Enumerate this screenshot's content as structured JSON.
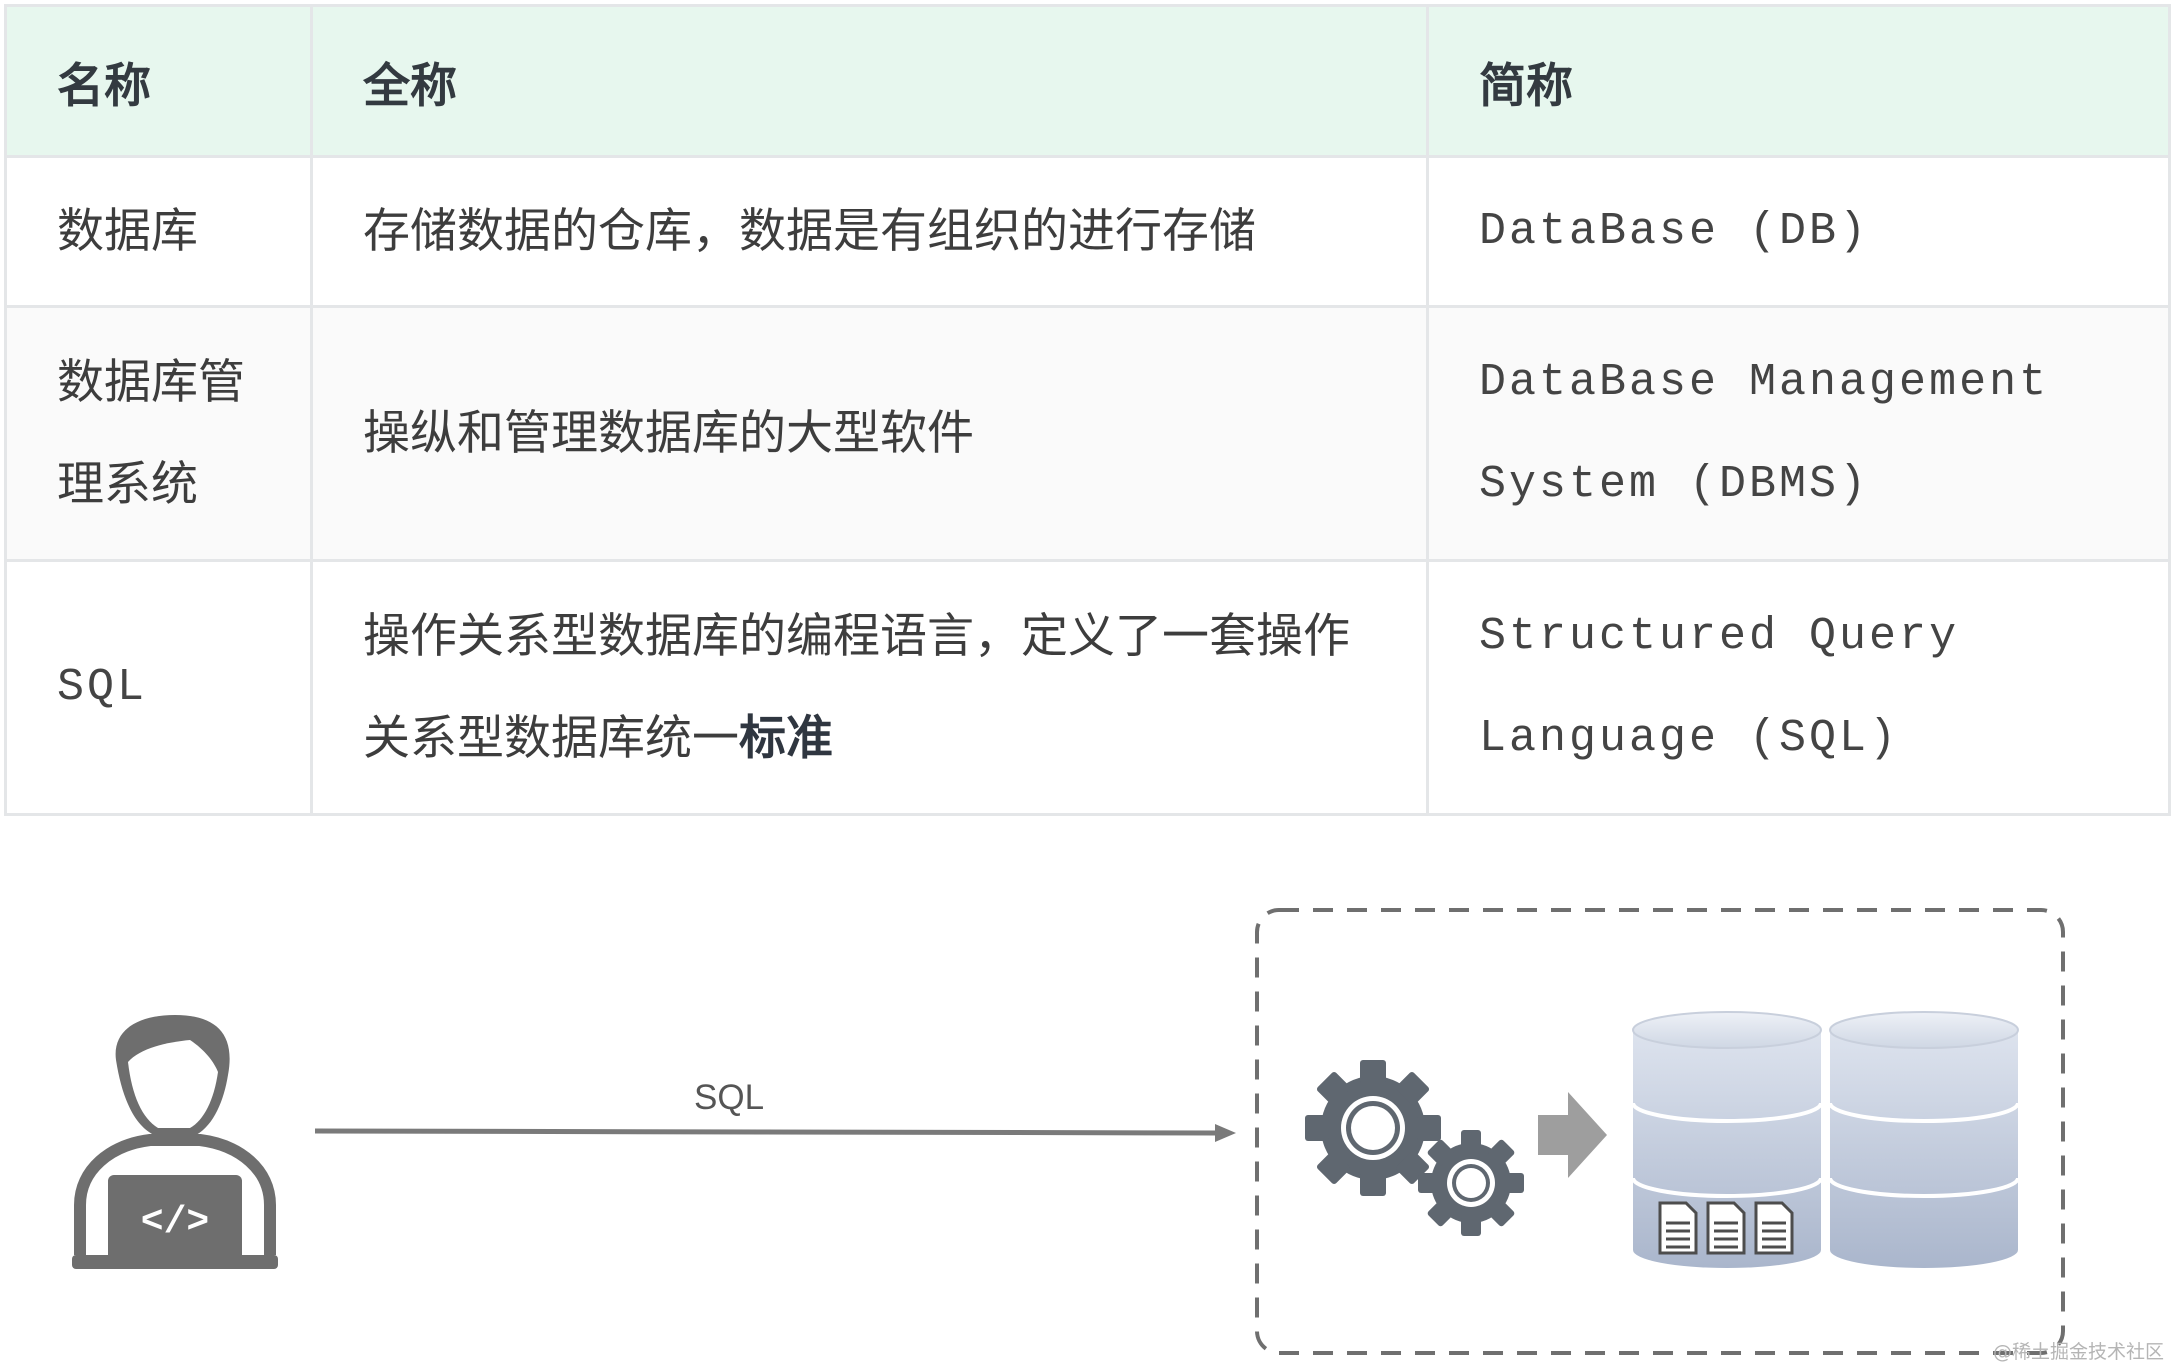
{
  "table": {
    "headers": [
      "名称",
      "全称",
      "简称"
    ],
    "rows": [
      {
        "name_lines": [
          "数据库"
        ],
        "full_lines": [
          "存储数据的仓库，数据是有组织的进行存储"
        ],
        "abbr_lines": [
          "DataBase (DB)"
        ]
      },
      {
        "name_lines": [
          "数据库管",
          "理系统"
        ],
        "full_lines": [
          "操纵和管理数据库的大型软件"
        ],
        "abbr_lines": [
          "DataBase Management",
          "System (DBMS)"
        ]
      },
      {
        "name_lines": [
          "SQL"
        ],
        "full_line1": "操作关系型数据库的编程语言，定义了一套操作",
        "full_line2_plain": "关系型数据库统一",
        "full_line2_bold": "标准",
        "abbr_lines": [
          "Structured Query",
          "Language (SQL)"
        ]
      }
    ]
  },
  "diagram": {
    "arrow_label": "SQL",
    "laptop_code_icon_text": "</>"
  },
  "watermark": "@稀土掘金技术社区",
  "colors": {
    "header_bg": "#e7f7ee",
    "border": "#e4e6e8",
    "icon_gray": "#6e6e6e",
    "db_blue": "#b9c3d6"
  }
}
